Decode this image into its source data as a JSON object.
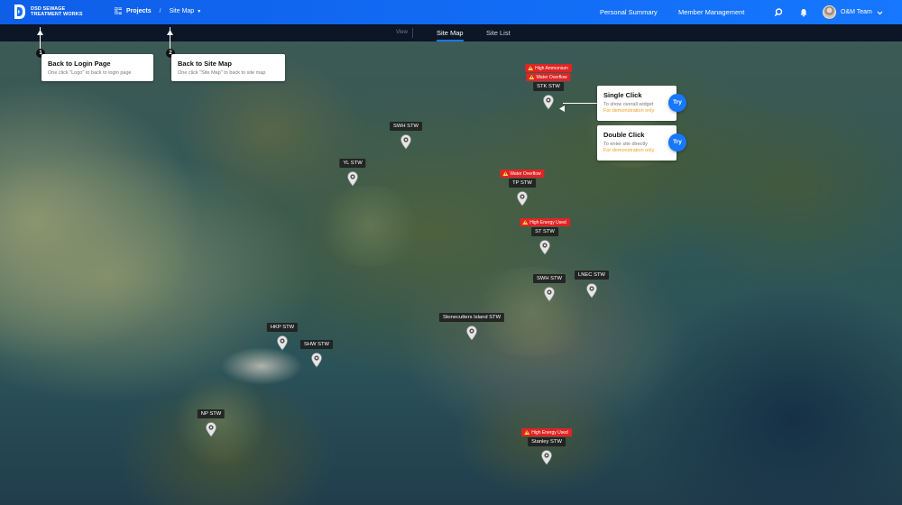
{
  "header": {
    "logo_text_line1": "DSD SEWAGE",
    "logo_text_line2": "TREATMENT WORKS",
    "projects_label": "Projects",
    "breadcrumb_separator": "/",
    "breadcrumb_current": "Site Map",
    "nav_personal_summary": "Personal Summary",
    "nav_member_management": "Member Management",
    "user_name": "O&M Team",
    "colors": {
      "bar": "#1677ff"
    }
  },
  "tabs": {
    "view_label": "View",
    "site_map": "Site Map",
    "site_list": "Site List"
  },
  "guides": {
    "login": {
      "step": "1",
      "title": "Back to Login Page",
      "desc": "One click \"Logo\" to back to login page"
    },
    "sitemap": {
      "step": "2",
      "title": "Back to Site Map",
      "desc": "One click \"Site Map\" to back to site map"
    },
    "single_click": {
      "title": "Single Click",
      "desc": "To show overall widget",
      "demo": "For demonstration only",
      "try": "Try"
    },
    "double_click": {
      "title": "Double Click",
      "desc": "To enter site directly",
      "demo": "For demonstration only",
      "try": "Try"
    }
  },
  "stations": [
    {
      "name": "STK STW",
      "alerts": [
        "High Ammonium",
        "Water Overflow"
      ]
    },
    {
      "name": "SWH STW",
      "alerts": []
    },
    {
      "name": "YL STW",
      "alerts": []
    },
    {
      "name": "TP STW",
      "alerts": [
        "Water Overflow"
      ]
    },
    {
      "name": "ST STW",
      "alerts": [
        "High Energy Used"
      ]
    },
    {
      "name": "SWH STW",
      "alerts": []
    },
    {
      "name": "LNEC STW",
      "alerts": []
    },
    {
      "name": "Stonecutters Island STW",
      "alerts": []
    },
    {
      "name": "HKP STW",
      "alerts": []
    },
    {
      "name": "SHW STW",
      "alerts": []
    },
    {
      "name": "NP STW",
      "alerts": []
    },
    {
      "name": "Stanley STW",
      "alerts": [
        "High Energy Used"
      ]
    }
  ],
  "alert_color": "#e02424"
}
